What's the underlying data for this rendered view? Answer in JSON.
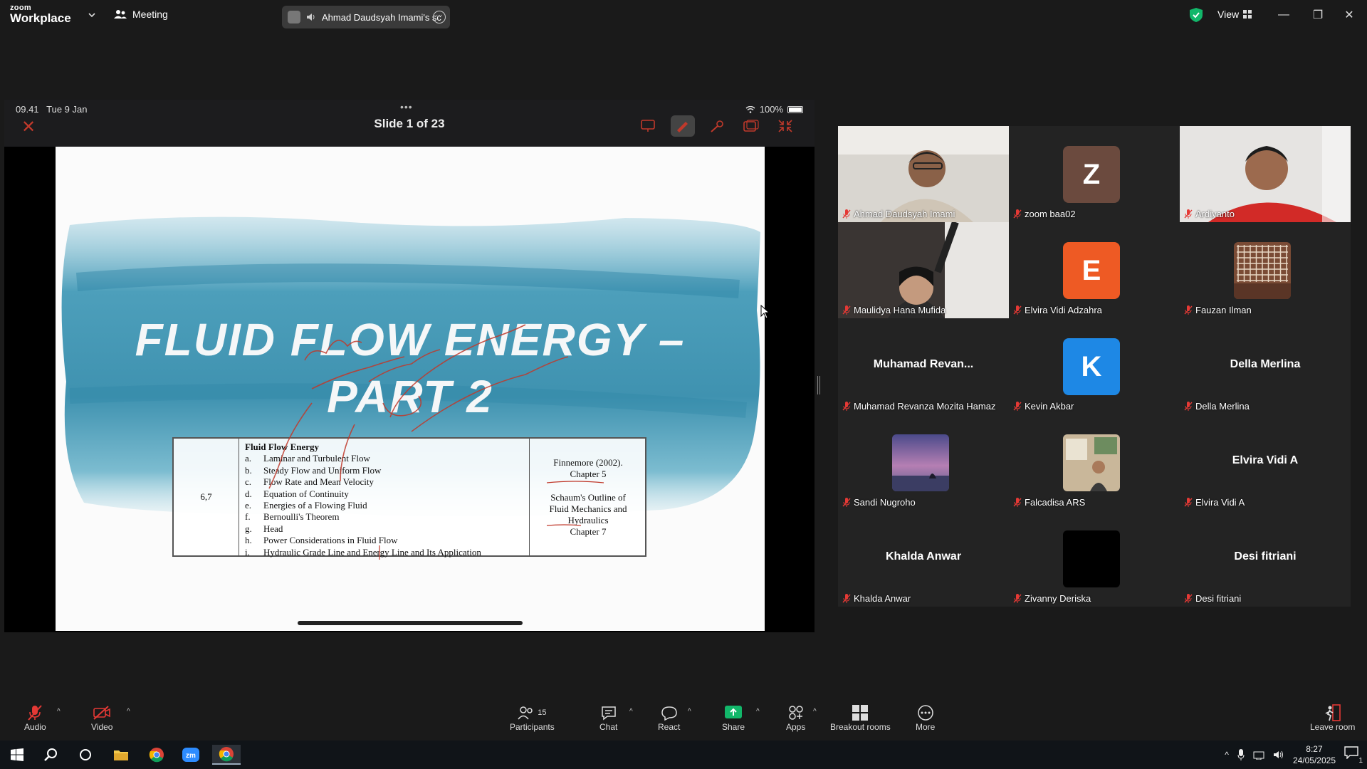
{
  "app": {
    "brand_small": "zoom",
    "brand_big": "Workplace",
    "meeting_label": "Meeting",
    "share_label": "Ahmad Daudsyah Imami's sc",
    "view_label": "View"
  },
  "shared_screen": {
    "time": "09.41",
    "date": "Tue 9 Jan",
    "slide_counter": "Slide 1 of 23",
    "battery": "100%",
    "slide": {
      "title_line1": "FLUID FLOW ENERGY –",
      "title_line2": "PART 2",
      "table": {
        "week": "6,7",
        "heading": "Fluid Flow Energy",
        "topics": [
          {
            "k": "a.",
            "t": "Laminar and Turbulent Flow"
          },
          {
            "k": "b.",
            "t": "Steady Flow and Uniform Flow"
          },
          {
            "k": "c.",
            "t": "Flow Rate and Mean Velocity"
          },
          {
            "k": "d.",
            "t": "Equation of Continuity"
          },
          {
            "k": "e.",
            "t": "Energies of a Flowing Fluid"
          },
          {
            "k": "f.",
            "t": "Bernoulli's Theorem"
          },
          {
            "k": "g.",
            "t": "Head"
          },
          {
            "k": "h.",
            "t": "Power Considerations in Fluid Flow"
          },
          {
            "k": "i.",
            "t": "Hydraulic Grade Line and Energy Line and Its Application"
          }
        ],
        "ref1_line1": "Finnemore (2002).",
        "ref1_line2": "Chapter 5",
        "ref2_line1": "Schaum's Outline of",
        "ref2_line2": "Fluid Mechanics and",
        "ref2_line3": "Hydraulics",
        "ref2_line4": "Chapter 7"
      }
    }
  },
  "participants": [
    {
      "name": "Ahmad Daudsyah Imami",
      "type": "video",
      "talking": true
    },
    {
      "name": "zoom baa02",
      "type": "letter",
      "letter": "Z",
      "color": "#6b4a3e"
    },
    {
      "name": "Ardiyanto",
      "type": "video"
    },
    {
      "name": "Maulidya Hana Mufida",
      "type": "video"
    },
    {
      "name": "Elvira Vidi Adzahra",
      "type": "letter",
      "letter": "E",
      "color": "#ee5a24"
    },
    {
      "name": "Fauzan Ilman",
      "type": "thumb"
    },
    {
      "name": "Muhamad Revanza Mozita Hamaz",
      "display": "Muhamad  Revan...",
      "type": "name"
    },
    {
      "name": "Kevin Akbar",
      "type": "letter",
      "letter": "K",
      "color": "#1e88e5"
    },
    {
      "name": "Della Merlina",
      "display": "Della Merlina",
      "type": "name"
    },
    {
      "name": "Sandi Nugroho",
      "type": "thumb"
    },
    {
      "name": "Falcadisa ARS",
      "type": "thumb"
    },
    {
      "name": "Elvira Vidi A",
      "display": "Elvira Vidi A",
      "type": "name"
    },
    {
      "name": "Khalda Anwar",
      "display": "Khalda Anwar",
      "type": "name"
    },
    {
      "name": "Zivanny Deriska",
      "type": "thumb"
    },
    {
      "name": "Desi fitriani",
      "display": "Desi fitriani",
      "type": "name"
    }
  ],
  "toolbar": {
    "audio": "Audio",
    "video": "Video",
    "participants": "Participants",
    "participants_count": "15",
    "chat": "Chat",
    "react": "React",
    "share": "Share",
    "apps": "Apps",
    "breakout": "Breakout rooms",
    "more": "More",
    "leave": "Leave room"
  },
  "taskbar": {
    "time": "8:27",
    "date": "24/05/2025",
    "notif_count": "1"
  },
  "colors": {
    "talking_outline": "#23d9a5",
    "share_green": "#12b76a",
    "muted_red": "#e53935"
  }
}
